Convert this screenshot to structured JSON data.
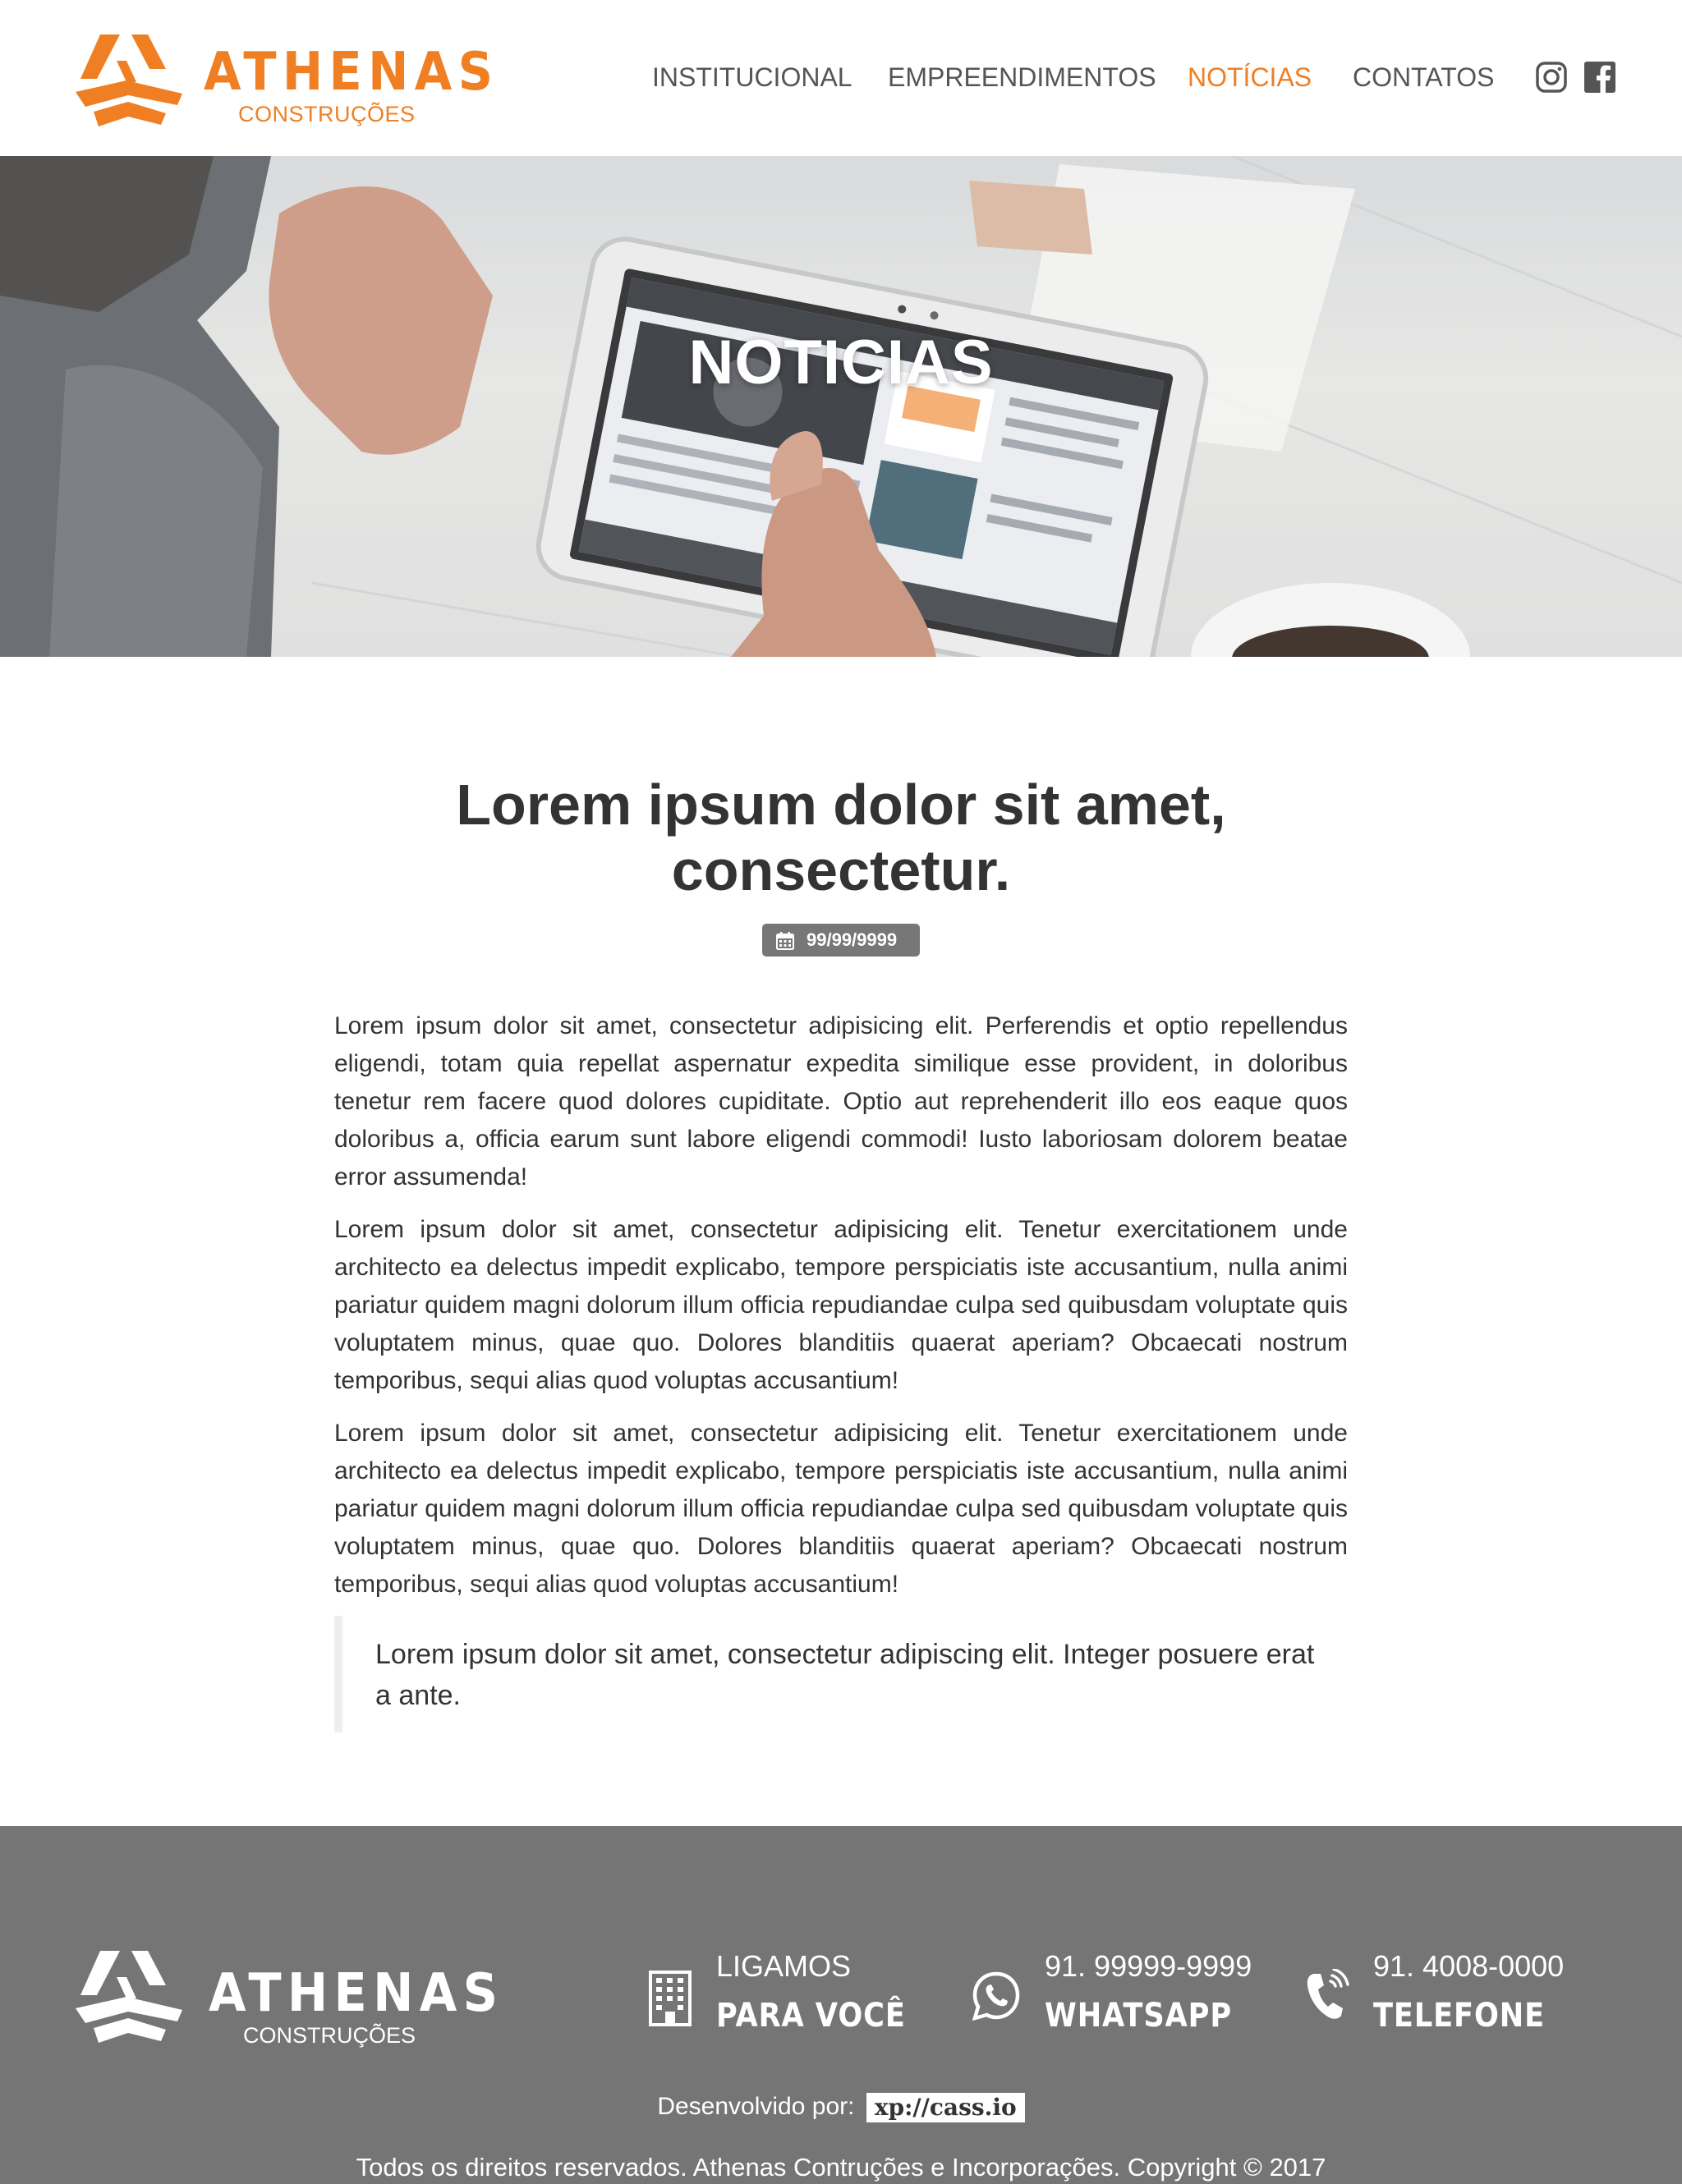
{
  "brand": {
    "name": "ATHENAS",
    "tagline": "CONSTRUÇÕES",
    "accent_color": "#f07f23"
  },
  "nav": {
    "items": [
      {
        "label": "INSTITUCIONAL",
        "active": false
      },
      {
        "label": "EMPREENDIMENTOS",
        "active": false
      },
      {
        "label": "NOTÍCIAS",
        "active": true
      },
      {
        "label": "CONTATOS",
        "active": false
      }
    ],
    "social": [
      "instagram-icon",
      "facebook-icon"
    ]
  },
  "hero": {
    "title": "NOTICIAS"
  },
  "article": {
    "title": "Lorem ipsum dolor sit amet, consectetur.",
    "date": "99/99/9999",
    "paragraphs": [
      "Lorem ipsum dolor sit amet, consectetur adipisicing elit. Perferendis et optio repellendus eligendi, totam quia repellat aspernatur expedita similique esse provident, in doloribus tenetur rem facere quod dolores cupiditate. Optio aut reprehenderit illo eos eaque quos doloribus a, officia earum sunt labore eligendi commodi! Iusto laboriosam dolorem beatae error assumenda!",
      "Lorem ipsum dolor sit amet, consectetur adipisicing elit. Tenetur exercitationem unde architecto ea delectus impedit explicabo, tempore perspiciatis iste accusantium, nulla animi pariatur quidem magni dolorum illum officia repudiandae culpa sed quibusdam voluptate quis voluptatem minus, quae quo. Dolores blanditiis quaerat aperiam? Obcaecati nostrum temporibus, sequi alias quod voluptas accusantium!",
      "Lorem ipsum dolor sit amet, consectetur adipisicing elit. Tenetur exercitationem unde architecto ea delectus impedit explicabo, tempore perspiciatis iste accusantium, nulla animi pariatur quidem magni dolorum illum officia repudiandae culpa sed quibusdam voluptate quis voluptatem minus, quae quo. Dolores blanditiis quaerat aperiam? Obcaecati nostrum temporibus, sequi alias quod voluptas accusantium!"
    ],
    "quote": "Lorem ipsum dolor sit amet, consectetur adipiscing elit. Integer posuere erat a ante."
  },
  "footer": {
    "background_color": "#757575",
    "contacts": [
      {
        "icon": "building-icon",
        "top": "LIGAMOS",
        "bottom": "PARA VOCÊ"
      },
      {
        "icon": "whatsapp-icon",
        "top": "91. 99999-9999",
        "bottom": "WHATSAPP"
      },
      {
        "icon": "phone-icon",
        "top": "91. 4008-0000",
        "bottom": "TELEFONE"
      }
    ],
    "developed_by_label": "Desenvolvido por:",
    "developer": "xp://cass.io",
    "copyright": "Todos os direitos reservados. Athenas Contruções e Incorporações. Copyright © 2017"
  }
}
